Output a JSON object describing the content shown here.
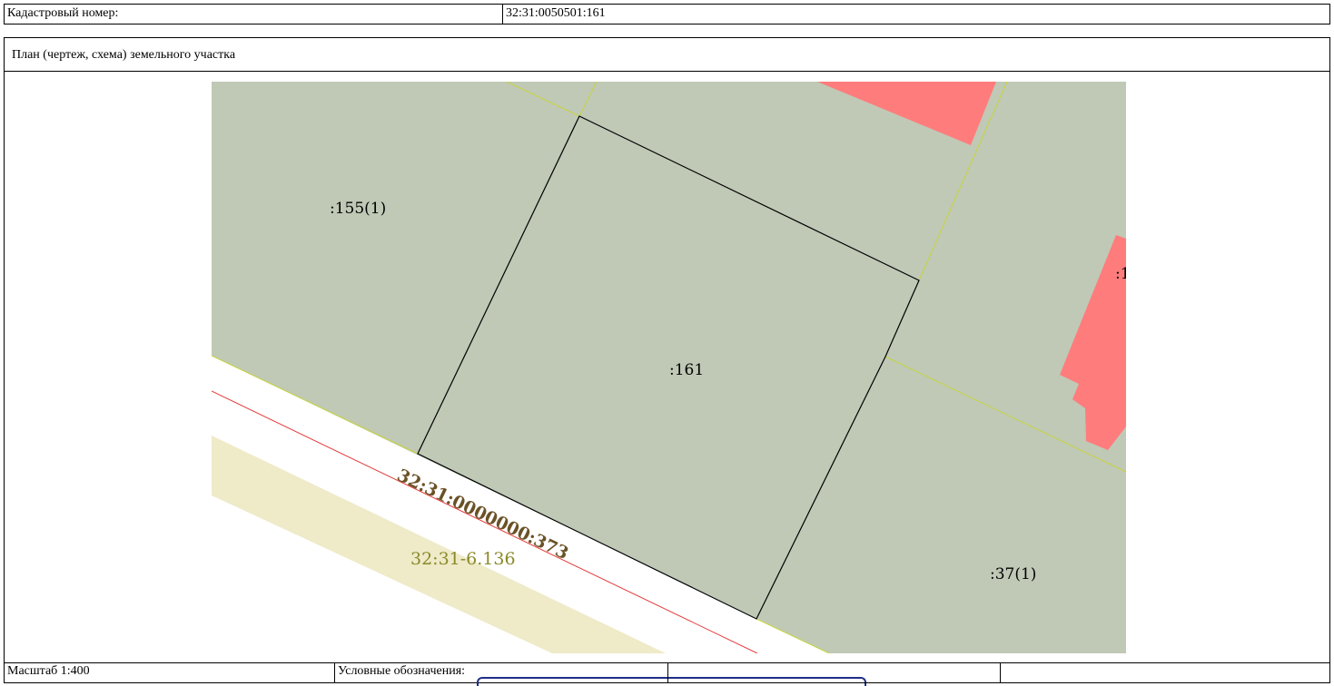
{
  "header": {
    "cadastral_label": "Кадастровый номер:",
    "cadastral_value": "32:31:0050501:161"
  },
  "plan": {
    "title": "План (чертеж, схема) земельного участка"
  },
  "map": {
    "labels": {
      "parcel_155": ":155(1)",
      "parcel_161": ":161",
      "parcel_37": ":37(1)",
      "road_parcel": "32:31:0000000:373",
      "zone": "32:31-6.136",
      "partial_right": ":1"
    },
    "colors": {
      "parcel_fill": "#bfc9b6",
      "building_fill": "#ff7c7c",
      "zone_fill": "#efeac8",
      "boundary_line": "#c8d43c",
      "red_line": "#e33c3c",
      "road_label": "#6b5226",
      "zone_label": "#8a8a2a"
    }
  },
  "footer": {
    "scale": "Масштаб 1:400",
    "legend_label": "Условные обозначения:"
  }
}
